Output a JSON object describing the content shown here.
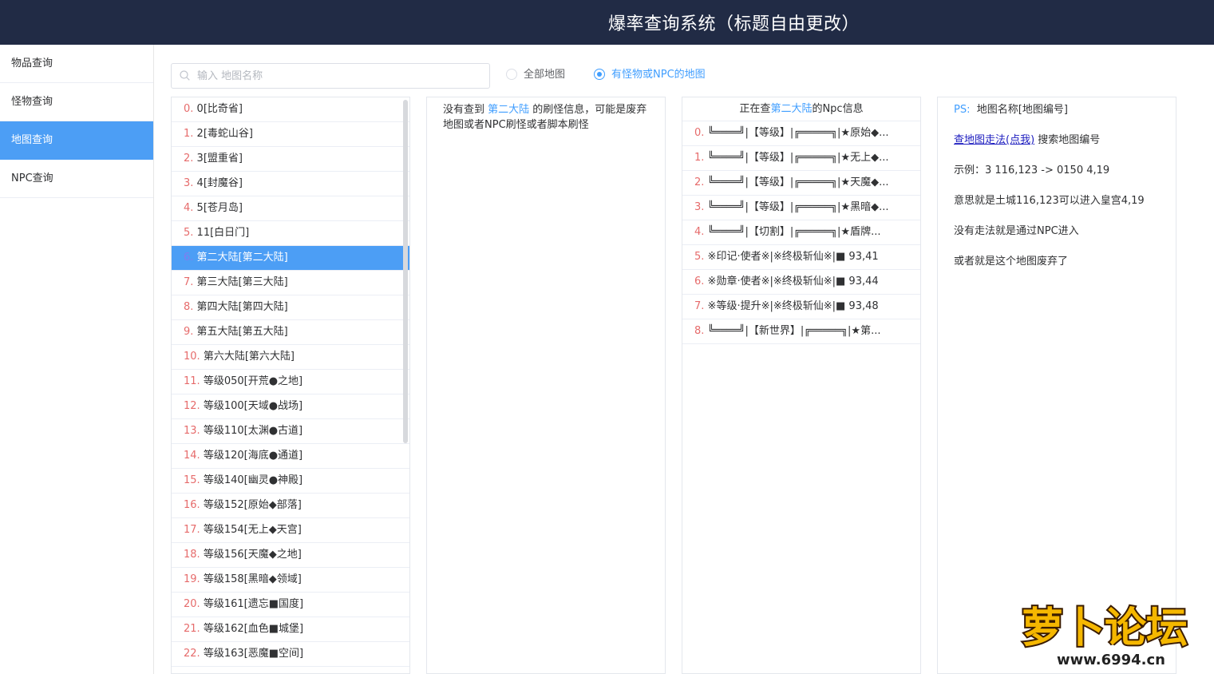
{
  "header": {
    "title": "爆率查询系统（标题自由更改）"
  },
  "sidebar": {
    "items": [
      {
        "label": "物品查询"
      },
      {
        "label": "怪物查询"
      },
      {
        "label": "地图查询"
      },
      {
        "label": "NPC查询"
      }
    ],
    "active_index": 2
  },
  "search": {
    "placeholder": "输入 地图名称",
    "value": ""
  },
  "filters": {
    "all_label": "全部地图",
    "monster_label": "有怪物或NPC的地图",
    "selected": "monster"
  },
  "map_list": [
    {
      "idx": "0.",
      "name": "0[比奇省]"
    },
    {
      "idx": "1.",
      "name": "2[毒蛇山谷]"
    },
    {
      "idx": "2.",
      "name": "3[盟重省]"
    },
    {
      "idx": "3.",
      "name": "4[封魔谷]"
    },
    {
      "idx": "4.",
      "name": "5[苍月岛]"
    },
    {
      "idx": "5.",
      "name": "11[白日门]"
    },
    {
      "idx": "6.",
      "name": "第二大陆[第二大陆]"
    },
    {
      "idx": "7.",
      "name": "第三大陆[第三大陆]"
    },
    {
      "idx": "8.",
      "name": "第四大陆[第四大陆]"
    },
    {
      "idx": "9.",
      "name": "第五大陆[第五大陆]"
    },
    {
      "idx": "10.",
      "name": "第六大陆[第六大陆]"
    },
    {
      "idx": "11.",
      "name": "等级050[开荒●之地]"
    },
    {
      "idx": "12.",
      "name": "等级100[天域●战场]"
    },
    {
      "idx": "13.",
      "name": "等级110[太渊●古道]"
    },
    {
      "idx": "14.",
      "name": "等级120[海底●通道]"
    },
    {
      "idx": "15.",
      "name": "等级140[幽灵●神殿]"
    },
    {
      "idx": "16.",
      "name": "等级152[原始◆部落]"
    },
    {
      "idx": "17.",
      "name": "等级154[无上◆天宫]"
    },
    {
      "idx": "18.",
      "name": "等级156[天魔◆之地]"
    },
    {
      "idx": "19.",
      "name": "等级158[黑暗◆领域]"
    },
    {
      "idx": "20.",
      "name": "等级161[遗忘■国度]"
    },
    {
      "idx": "21.",
      "name": "等级162[血色■城堡]"
    },
    {
      "idx": "22.",
      "name": "等级163[恶魔■空间]"
    }
  ],
  "map_list_active_index": 6,
  "info": {
    "prefix": "没有查到 ",
    "map_name": "第二大陆",
    "suffix": " 的刷怪信息，可能是废弃地图或者NPC刷怪或者脚本刷怪"
  },
  "npc": {
    "head_prefix": "正在查",
    "head_map": "第二大陆",
    "head_suffix": "的Npc信息",
    "rows": [
      {
        "idx": "0.",
        "text": "╚════╝|【等级】|╔═════╗|★原始◆..."
      },
      {
        "idx": "1.",
        "text": "╚════╝|【等级】|╔═════╗|★无上◆..."
      },
      {
        "idx": "2.",
        "text": "╚════╝|【等级】|╔═════╗|★天魔◆..."
      },
      {
        "idx": "3.",
        "text": "╚════╝|【等级】|╔═════╗|★黑暗◆..."
      },
      {
        "idx": "4.",
        "text": "╚════╝|【切割】|╔═════╗|★盾牌..."
      },
      {
        "idx": "5.",
        "text": "※印记·使者※|※终极斩仙※|■ 93,41"
      },
      {
        "idx": "6.",
        "text": "※勋章·使者※|※终极斩仙※|■ 93,44"
      },
      {
        "idx": "7.",
        "text": "※等级·提升※|※终极斩仙※|■ 93,48"
      },
      {
        "idx": "8.",
        "text": "╚════╝|【新世界】|╔═════╗|★第..."
      }
    ]
  },
  "ps": {
    "label": "PS:",
    "line1": "地图名称[地图编号]",
    "link": "查地图走法(点我)",
    "link_suffix": " 搜索地图编号",
    "example": "示例：3 116,123 -> 0150 4,19",
    "meaning": "意思就是土城116,123可以进入皇宫4,19",
    "no_route": "没有走法就是通过NPC进入",
    "abandoned": "或者就是这个地图废弃了"
  },
  "logo": {
    "text": "萝卜论坛",
    "url_text": "www.6994.cn"
  },
  "colors": {
    "header_bg": "#212b45",
    "accent": "#409eff",
    "active_bg": "#4c9ef5",
    "index_red": "#e66b6b"
  }
}
